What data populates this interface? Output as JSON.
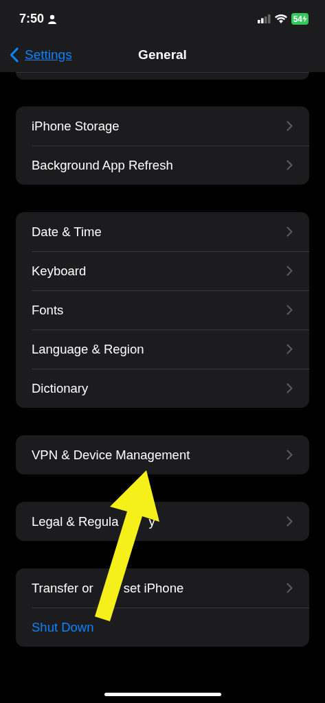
{
  "status_bar": {
    "time": "7:50",
    "battery": "54"
  },
  "nav": {
    "back": "Settings",
    "title": "General"
  },
  "groups": [
    {
      "items": [
        {
          "label": "iPhone Storage",
          "kind": "chevron"
        },
        {
          "label": "Background App Refresh",
          "kind": "chevron"
        }
      ]
    },
    {
      "items": [
        {
          "label": "Date & Time",
          "kind": "chevron"
        },
        {
          "label": "Keyboard",
          "kind": "chevron"
        },
        {
          "label": "Fonts",
          "kind": "chevron"
        },
        {
          "label": "Language & Region",
          "kind": "chevron"
        },
        {
          "label": "Dictionary",
          "kind": "chevron"
        }
      ]
    },
    {
      "items": [
        {
          "label": "VPN & Device Management",
          "kind": "chevron"
        }
      ]
    },
    {
      "items": [
        {
          "label": "Legal & Regula",
          "label_after_arrow": "y",
          "kind": "chevron"
        }
      ]
    },
    {
      "items": [
        {
          "label": "Transfer or",
          "label_after_arrow": "set iPhone",
          "kind": "chevron"
        },
        {
          "label": "Shut Down",
          "kind": "action"
        }
      ]
    }
  ]
}
